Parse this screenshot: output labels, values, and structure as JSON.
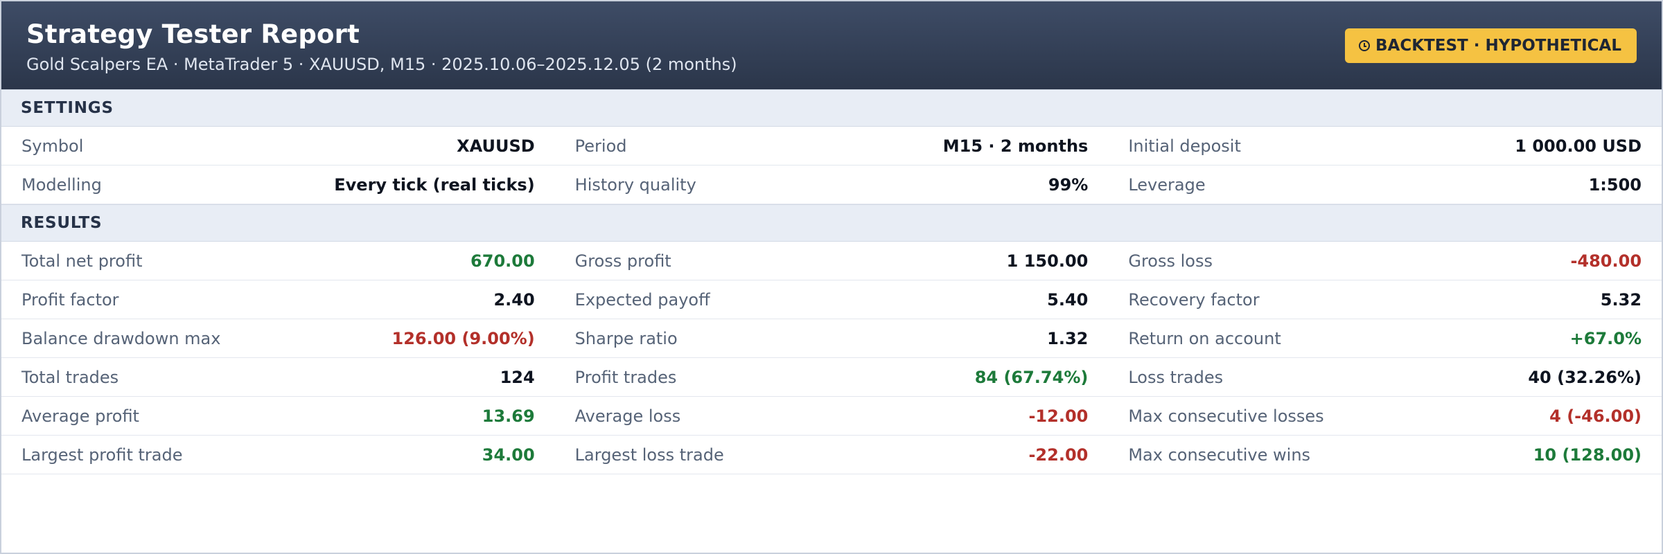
{
  "header": {
    "title": "Strategy Tester Report",
    "subtitle": "Gold Scalpers EA · MetaTrader 5 · XAUUSD, M15 · 2025.10.06–2025.12.05 (2 months)",
    "badge_label": "BACKTEST · HYPOTHETICAL",
    "badge_icon": "clock-icon",
    "badge_color": "#f5c242"
  },
  "colors": {
    "header_bg": "#2f3a50",
    "positive": "#1d7a3a",
    "negative": "#b3302a"
  },
  "settings": {
    "heading": "SETTINGS",
    "rows": [
      [
        {
          "label": "Symbol",
          "value": "XAUUSD",
          "tone": "neutral"
        },
        {
          "label": "Period",
          "value": "M15 · 2 months",
          "tone": "neutral"
        },
        {
          "label": "Initial deposit",
          "value": "1 000.00 USD",
          "tone": "neutral"
        }
      ],
      [
        {
          "label": "Modelling",
          "value": "Every tick (real ticks)",
          "tone": "neutral"
        },
        {
          "label": "History quality",
          "value": "99%",
          "tone": "neutral"
        },
        {
          "label": "Leverage",
          "value": "1:500",
          "tone": "neutral"
        }
      ]
    ]
  },
  "results": {
    "heading": "RESULTS",
    "rows": [
      [
        {
          "label": "Total net profit",
          "value": "670.00",
          "tone": "pos"
        },
        {
          "label": "Gross profit",
          "value": "1 150.00",
          "tone": "neutral"
        },
        {
          "label": "Gross loss",
          "value": "-480.00",
          "tone": "neg"
        }
      ],
      [
        {
          "label": "Profit factor",
          "value": "2.40",
          "tone": "neutral"
        },
        {
          "label": "Expected payoff",
          "value": "5.40",
          "tone": "neutral"
        },
        {
          "label": "Recovery factor",
          "value": "5.32",
          "tone": "neutral"
        }
      ],
      [
        {
          "label": "Balance drawdown max",
          "value": "126.00 (9.00%)",
          "tone": "neg"
        },
        {
          "label": "Sharpe ratio",
          "value": "1.32",
          "tone": "neutral"
        },
        {
          "label": "Return on account",
          "value": "+67.0%",
          "tone": "pos"
        }
      ],
      [
        {
          "label": "Total trades",
          "value": "124",
          "tone": "neutral"
        },
        {
          "label": "Profit trades",
          "value": "84 (67.74%)",
          "tone": "pos"
        },
        {
          "label": "Loss trades",
          "value": "40 (32.26%)",
          "tone": "neutral"
        }
      ],
      [
        {
          "label": "Average profit",
          "value": "13.69",
          "tone": "pos"
        },
        {
          "label": "Average loss",
          "value": "-12.00",
          "tone": "neg"
        },
        {
          "label": "Max consecutive losses",
          "value": "4 (-46.00)",
          "tone": "neg"
        }
      ],
      [
        {
          "label": "Largest profit trade",
          "value": "34.00",
          "tone": "pos"
        },
        {
          "label": "Largest loss trade",
          "value": "-22.00",
          "tone": "neg"
        },
        {
          "label": "Max consecutive wins",
          "value": "10 (128.00)",
          "tone": "pos"
        }
      ]
    ]
  }
}
